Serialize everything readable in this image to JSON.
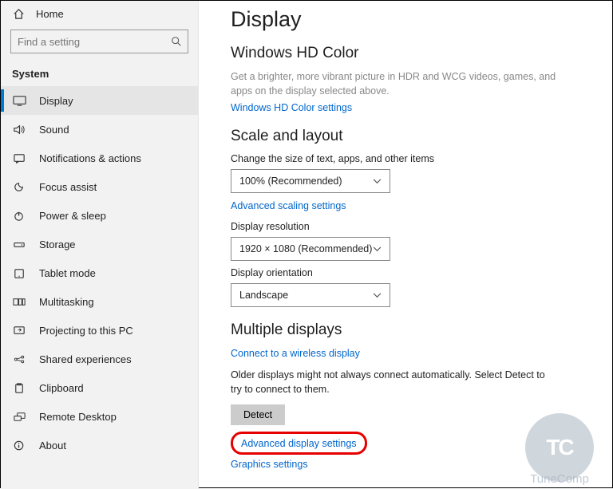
{
  "sidebar": {
    "home": "Home",
    "search_placeholder": "Find a setting",
    "category": "System",
    "items": [
      {
        "label": "Display"
      },
      {
        "label": "Sound"
      },
      {
        "label": "Notifications & actions"
      },
      {
        "label": "Focus assist"
      },
      {
        "label": "Power & sleep"
      },
      {
        "label": "Storage"
      },
      {
        "label": "Tablet mode"
      },
      {
        "label": "Multitasking"
      },
      {
        "label": "Projecting to this PC"
      },
      {
        "label": "Shared experiences"
      },
      {
        "label": "Clipboard"
      },
      {
        "label": "Remote Desktop"
      },
      {
        "label": "About"
      }
    ]
  },
  "main": {
    "title": "Display",
    "hd": {
      "heading": "Windows HD Color",
      "desc": "Get a brighter, more vibrant picture in HDR and WCG videos, games, and apps on the display selected above.",
      "link": "Windows HD Color settings"
    },
    "scale": {
      "heading": "Scale and layout",
      "size_label": "Change the size of text, apps, and other items",
      "size_value": "100% (Recommended)",
      "adv_scaling_link": "Advanced scaling settings",
      "res_label": "Display resolution",
      "res_value": "1920 × 1080 (Recommended)",
      "orient_label": "Display orientation",
      "orient_value": "Landscape"
    },
    "multi": {
      "heading": "Multiple displays",
      "connect_link": "Connect to a wireless display",
      "older_text": "Older displays might not always connect automatically. Select Detect to try to connect to them.",
      "detect_btn": "Detect",
      "adv_display_link": "Advanced display settings",
      "graphics_link": "Graphics settings"
    }
  },
  "watermark": {
    "initials": "TC",
    "brand": "TuneComp"
  }
}
